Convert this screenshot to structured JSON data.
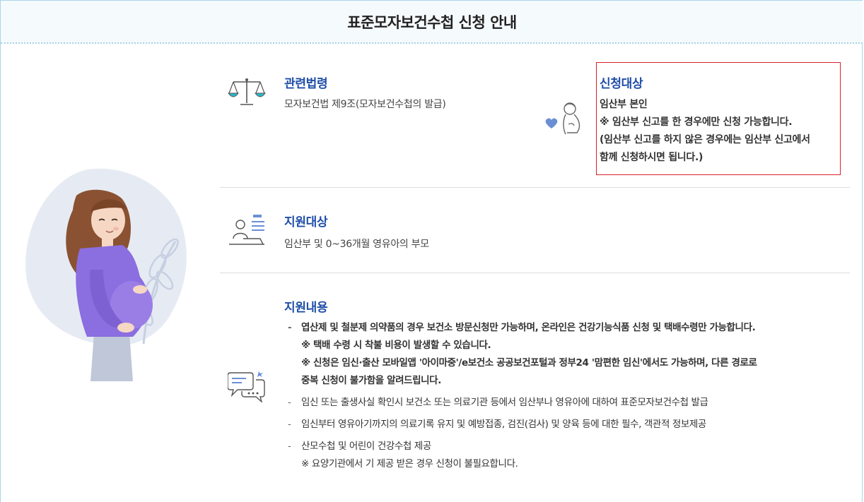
{
  "page": {
    "title": "표준모자보건수첩 신청 안내"
  },
  "sections": {
    "law": {
      "title": "관련법령",
      "text": "모자보건법 제9조(모자보건수첩의 발급)"
    },
    "applicant": {
      "title": "신청대상",
      "line1": "임산부 본인",
      "line2": "※ 임산부 신고를 한 경우에만 신청 가능합니다.",
      "line3": "(임산부 신고를 하지 않은 경우에는 임산부 신고에서",
      "line4": "함께 신청하시면 됩니다.)"
    },
    "target": {
      "title": "지원대상",
      "text": "임산부 및 0~36개월 영유아의 부모"
    },
    "content": {
      "title": "지원내용",
      "items": [
        {
          "text": "엽산제 및 철분제 의약품의 경우 보건소 방문신청만 가능하며, 온라인은 건강기능식품 신청 및 택배수령만 가능합니다.",
          "note1": "※ 택배 수령 시 착불 비용이 발생할 수 있습니다.",
          "note2": "※ 신청은 임신·출산 모바일앱 '아이마중'/e보건소 공공보건포털과 정부24 '맘편한 임신'에서도 가능하며, 다른 경로로",
          "note3": "중복 신청이 불가함을 알려드립니다."
        },
        {
          "text": "임신 또는 출생사실 확인시 보건소 또는 의료기관 등에서 임산부나 영유아에 대하여 표준모자보건수첩 발급"
        },
        {
          "text": "임신부터 영유아기까지의 의료기록 유지 및 예방접종, 검진(검사) 및 양육 등에 대한 필수, 객관적 정보제공"
        },
        {
          "text": "산모수첩 및 어린이 건강수첩 제공",
          "note1": "※ 요양기관에서 기 제공 받은 경우 신청이 불필요합니다."
        }
      ]
    }
  },
  "icons": {
    "law": "scales-icon",
    "applicant": "pregnant-woman-heart-icon",
    "target": "person-at-desk-icon",
    "content": "speech-bubbles-icon"
  },
  "colors": {
    "title_blue": "#1f4ea8",
    "icon_teal": "#2fb4c9",
    "highlight_red": "#d9212a",
    "illustration_purple": "#8b6ee0"
  }
}
